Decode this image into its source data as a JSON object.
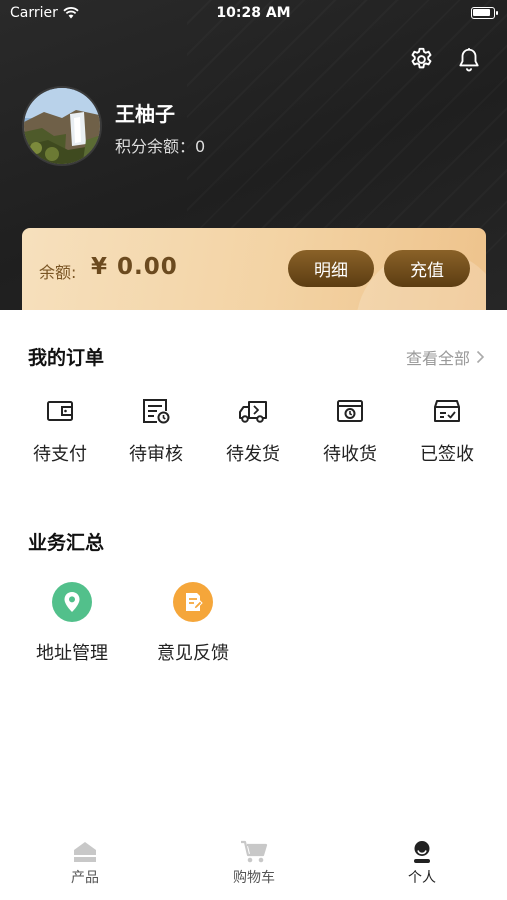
{
  "status_bar": {
    "carrier": "Carrier",
    "time": "10:28 AM"
  },
  "header": {
    "settings_icon": "gear-icon",
    "notification_icon": "bell-icon",
    "user_name": "王柚子",
    "points_text": "积分余额：0"
  },
  "balance": {
    "label": "余额:",
    "value": "¥ 0.00",
    "detail_button": "明细",
    "recharge_button": "充值"
  },
  "orders": {
    "title": "我的订单",
    "see_all": "查看全部",
    "items": [
      {
        "label": "待支付",
        "icon": "wallet-icon"
      },
      {
        "label": "待审核",
        "icon": "review-doc-icon"
      },
      {
        "label": "待发货",
        "icon": "truck-icon"
      },
      {
        "label": "待收货",
        "icon": "receive-box-icon"
      },
      {
        "label": "已签收",
        "icon": "signed-box-icon"
      }
    ]
  },
  "business": {
    "title": "业务汇总",
    "items": [
      {
        "label": "地址管理",
        "icon": "location-pin-icon",
        "color": "#52c08b"
      },
      {
        "label": "意见反馈",
        "icon": "feedback-edit-icon",
        "color": "#f5a63a"
      }
    ]
  },
  "tabs": [
    {
      "label": "产品",
      "icon": "home-icon",
      "active": false
    },
    {
      "label": "购物车",
      "icon": "cart-icon",
      "active": false
    },
    {
      "label": "个人",
      "icon": "person-icon",
      "active": true
    }
  ],
  "colors": {
    "accent_gold": "#6b4a1f",
    "header_dark": "#222222",
    "tab_inactive": "#c8c8c8",
    "tab_active": "#222222"
  }
}
